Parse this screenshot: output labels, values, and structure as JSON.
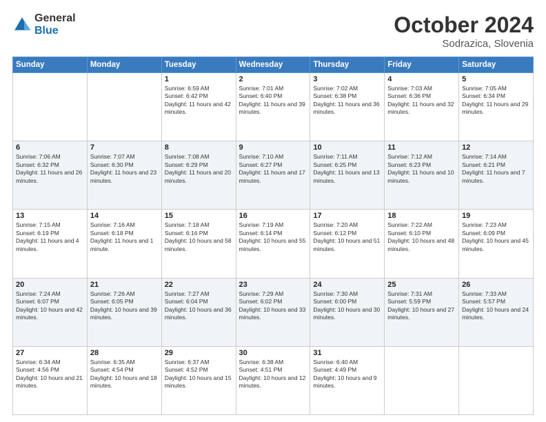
{
  "logo": {
    "general": "General",
    "blue": "Blue"
  },
  "title": {
    "month": "October 2024",
    "location": "Sodrazica, Slovenia"
  },
  "headers": [
    "Sunday",
    "Monday",
    "Tuesday",
    "Wednesday",
    "Thursday",
    "Friday",
    "Saturday"
  ],
  "weeks": [
    [
      {
        "day": "",
        "info": ""
      },
      {
        "day": "",
        "info": ""
      },
      {
        "day": "1",
        "info": "Sunrise: 6:59 AM\nSunset: 6:42 PM\nDaylight: 11 hours and 42 minutes."
      },
      {
        "day": "2",
        "info": "Sunrise: 7:01 AM\nSunset: 6:40 PM\nDaylight: 11 hours and 39 minutes."
      },
      {
        "day": "3",
        "info": "Sunrise: 7:02 AM\nSunset: 6:38 PM\nDaylight: 11 hours and 36 minutes."
      },
      {
        "day": "4",
        "info": "Sunrise: 7:03 AM\nSunset: 6:36 PM\nDaylight: 11 hours and 32 minutes."
      },
      {
        "day": "5",
        "info": "Sunrise: 7:05 AM\nSunset: 6:34 PM\nDaylight: 11 hours and 29 minutes."
      }
    ],
    [
      {
        "day": "6",
        "info": "Sunrise: 7:06 AM\nSunset: 6:32 PM\nDaylight: 11 hours and 26 minutes."
      },
      {
        "day": "7",
        "info": "Sunrise: 7:07 AM\nSunset: 6:30 PM\nDaylight: 11 hours and 23 minutes."
      },
      {
        "day": "8",
        "info": "Sunrise: 7:08 AM\nSunset: 6:29 PM\nDaylight: 11 hours and 20 minutes."
      },
      {
        "day": "9",
        "info": "Sunrise: 7:10 AM\nSunset: 6:27 PM\nDaylight: 11 hours and 17 minutes."
      },
      {
        "day": "10",
        "info": "Sunrise: 7:11 AM\nSunset: 6:25 PM\nDaylight: 11 hours and 13 minutes."
      },
      {
        "day": "11",
        "info": "Sunrise: 7:12 AM\nSunset: 6:23 PM\nDaylight: 11 hours and 10 minutes."
      },
      {
        "day": "12",
        "info": "Sunrise: 7:14 AM\nSunset: 6:21 PM\nDaylight: 11 hours and 7 minutes."
      }
    ],
    [
      {
        "day": "13",
        "info": "Sunrise: 7:15 AM\nSunset: 6:19 PM\nDaylight: 11 hours and 4 minutes."
      },
      {
        "day": "14",
        "info": "Sunrise: 7:16 AM\nSunset: 6:18 PM\nDaylight: 11 hours and 1 minute."
      },
      {
        "day": "15",
        "info": "Sunrise: 7:18 AM\nSunset: 6:16 PM\nDaylight: 10 hours and 58 minutes."
      },
      {
        "day": "16",
        "info": "Sunrise: 7:19 AM\nSunset: 6:14 PM\nDaylight: 10 hours and 55 minutes."
      },
      {
        "day": "17",
        "info": "Sunrise: 7:20 AM\nSunset: 6:12 PM\nDaylight: 10 hours and 51 minutes."
      },
      {
        "day": "18",
        "info": "Sunrise: 7:22 AM\nSunset: 6:10 PM\nDaylight: 10 hours and 48 minutes."
      },
      {
        "day": "19",
        "info": "Sunrise: 7:23 AM\nSunset: 6:09 PM\nDaylight: 10 hours and 45 minutes."
      }
    ],
    [
      {
        "day": "20",
        "info": "Sunrise: 7:24 AM\nSunset: 6:07 PM\nDaylight: 10 hours and 42 minutes."
      },
      {
        "day": "21",
        "info": "Sunrise: 7:26 AM\nSunset: 6:05 PM\nDaylight: 10 hours and 39 minutes."
      },
      {
        "day": "22",
        "info": "Sunrise: 7:27 AM\nSunset: 6:04 PM\nDaylight: 10 hours and 36 minutes."
      },
      {
        "day": "23",
        "info": "Sunrise: 7:29 AM\nSunset: 6:02 PM\nDaylight: 10 hours and 33 minutes."
      },
      {
        "day": "24",
        "info": "Sunrise: 7:30 AM\nSunset: 6:00 PM\nDaylight: 10 hours and 30 minutes."
      },
      {
        "day": "25",
        "info": "Sunrise: 7:31 AM\nSunset: 5:59 PM\nDaylight: 10 hours and 27 minutes."
      },
      {
        "day": "26",
        "info": "Sunrise: 7:33 AM\nSunset: 5:57 PM\nDaylight: 10 hours and 24 minutes."
      }
    ],
    [
      {
        "day": "27",
        "info": "Sunrise: 6:34 AM\nSunset: 4:56 PM\nDaylight: 10 hours and 21 minutes."
      },
      {
        "day": "28",
        "info": "Sunrise: 6:35 AM\nSunset: 4:54 PM\nDaylight: 10 hours and 18 minutes."
      },
      {
        "day": "29",
        "info": "Sunrise: 6:37 AM\nSunset: 4:52 PM\nDaylight: 10 hours and 15 minutes."
      },
      {
        "day": "30",
        "info": "Sunrise: 6:38 AM\nSunset: 4:51 PM\nDaylight: 10 hours and 12 minutes."
      },
      {
        "day": "31",
        "info": "Sunrise: 6:40 AM\nSunset: 4:49 PM\nDaylight: 10 hours and 9 minutes."
      },
      {
        "day": "",
        "info": ""
      },
      {
        "day": "",
        "info": ""
      }
    ]
  ]
}
